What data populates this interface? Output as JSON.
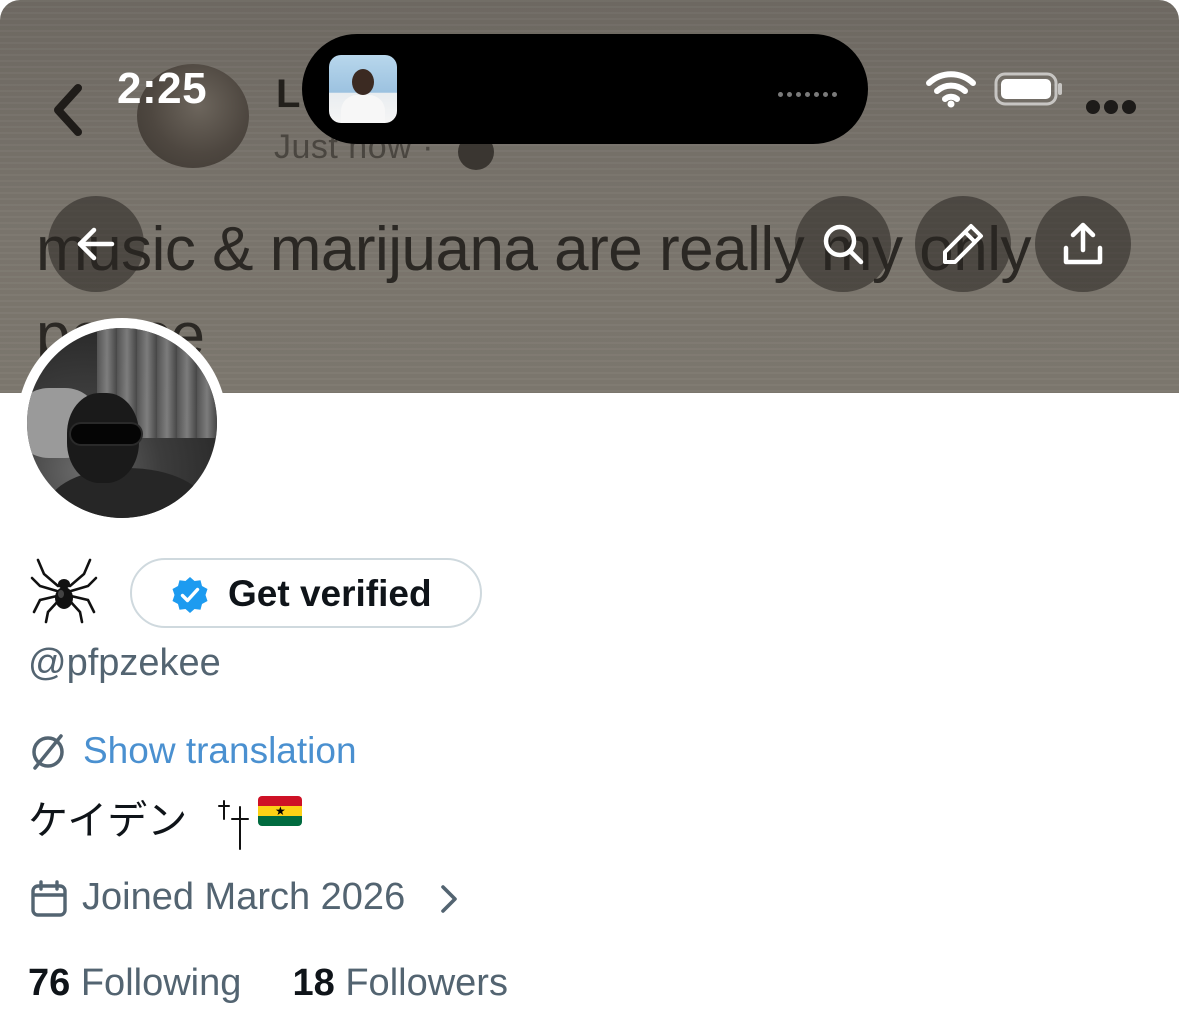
{
  "status_bar": {
    "time": "2:25"
  },
  "background_post": {
    "author_initial": "L",
    "timestamp": "Just now ·",
    "text_line1": "music & marijuana are really my only",
    "text_line2": "peace"
  },
  "header_actions": {
    "back_icon": "arrow-left-icon",
    "search_icon": "search-icon",
    "edit_icon": "pencil-icon",
    "share_icon": "share-upload-icon"
  },
  "profile": {
    "display_name_emoji": "🕷",
    "get_verified_label": "Get verified",
    "handle": "@pfpzekee",
    "show_translation_label": "Show translation",
    "bio_text": "ケイデン ",
    "joined_label": "Joined March 2026",
    "following_count": "76",
    "following_label": "Following",
    "followers_count": "18",
    "followers_label": "Followers"
  },
  "colors": {
    "link_blue": "#4a90d0",
    "verified_blue": "#1d9bf0",
    "secondary_text": "#536471",
    "primary_text": "#0f1419",
    "banner": "#7b766e"
  }
}
